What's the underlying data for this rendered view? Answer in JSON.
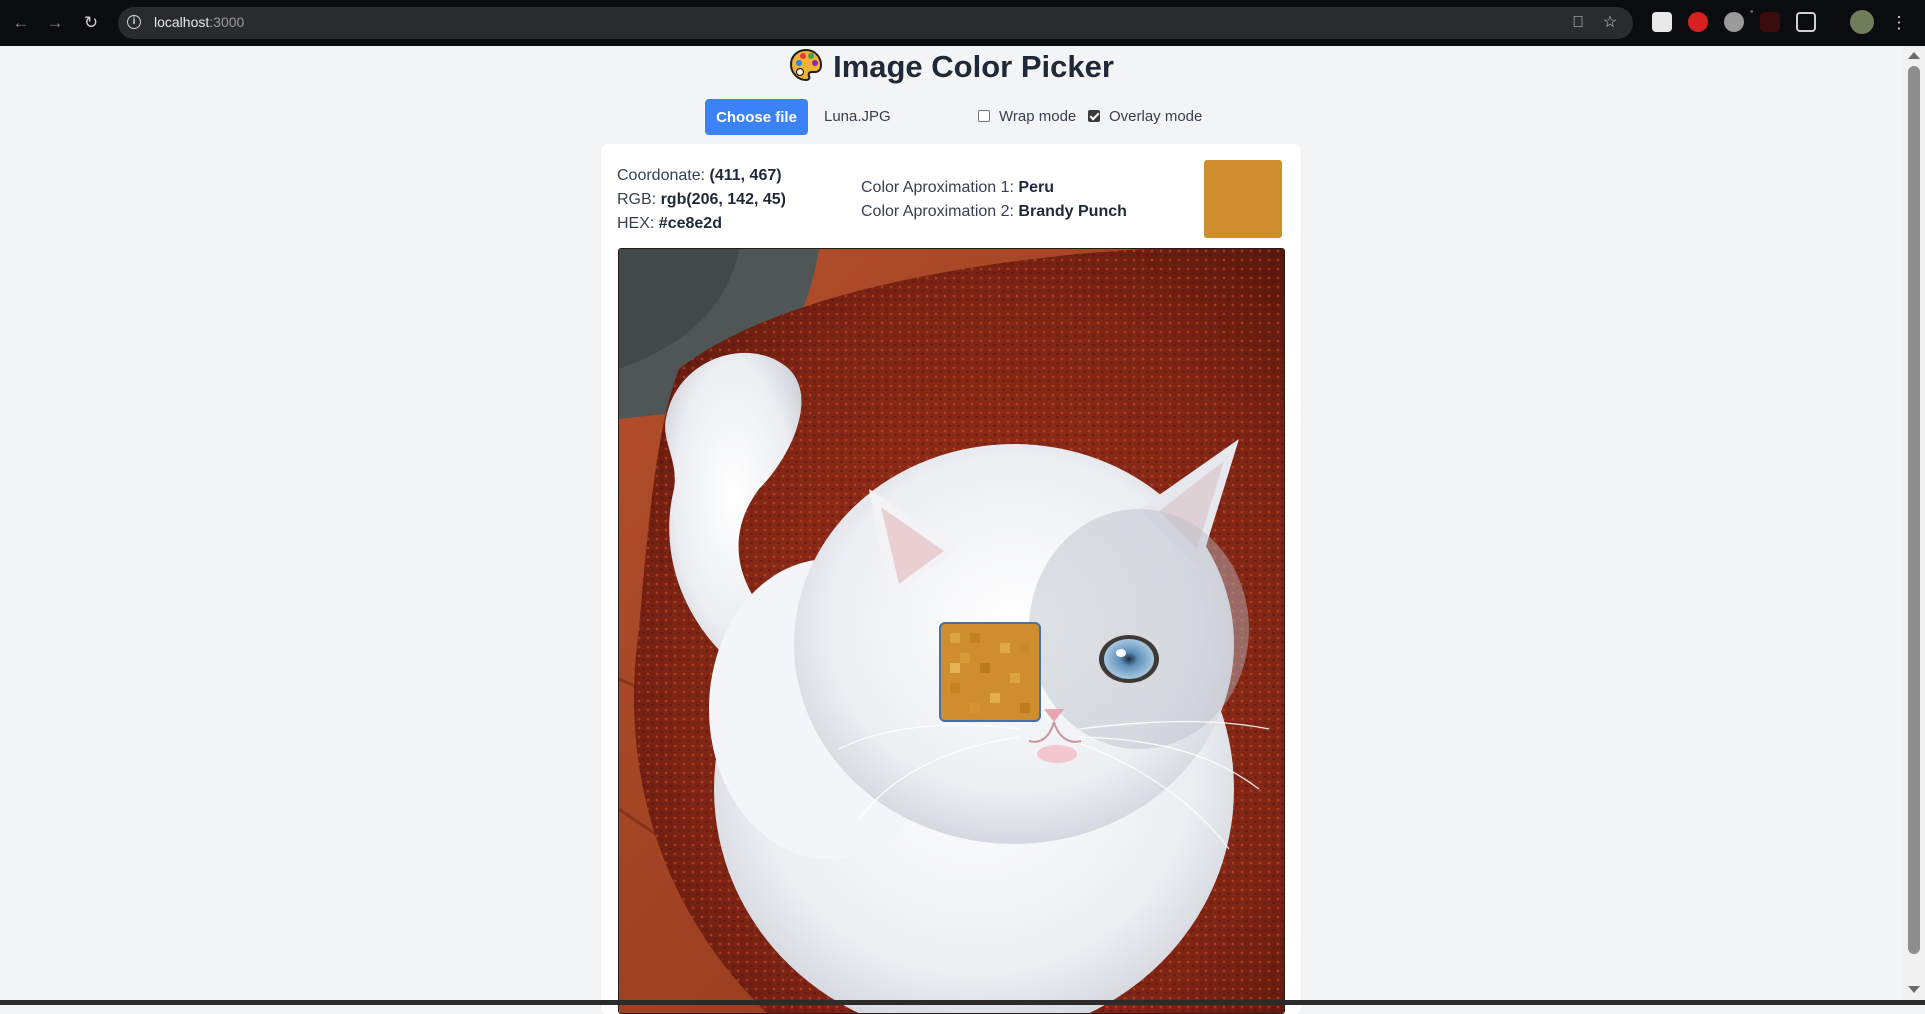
{
  "browser": {
    "url_host": "localhost",
    "url_port": ":3000"
  },
  "page": {
    "title": "Image Color Picker",
    "choose_file_label": "Choose file",
    "file_name": "Luna.JPG",
    "wrap_mode_label": "Wrap mode",
    "wrap_mode_checked": false,
    "overlay_mode_label": "Overlay mode",
    "overlay_mode_checked": true
  },
  "picker": {
    "coordinate_label": "Coordonate:",
    "coordinate_value": "(411, 467)",
    "rgb_label": "RGB:",
    "rgb_value": "rgb(206, 142, 45)",
    "hex_label": "HEX:",
    "hex_value": "#ce8e2d",
    "approx1_label": "Color Aproximation 1:",
    "approx1_value": "Peru",
    "approx2_label": "Color Aproximation 2:",
    "approx2_value": "Brandy Punch",
    "swatch_color": "#ce8e2d"
  }
}
